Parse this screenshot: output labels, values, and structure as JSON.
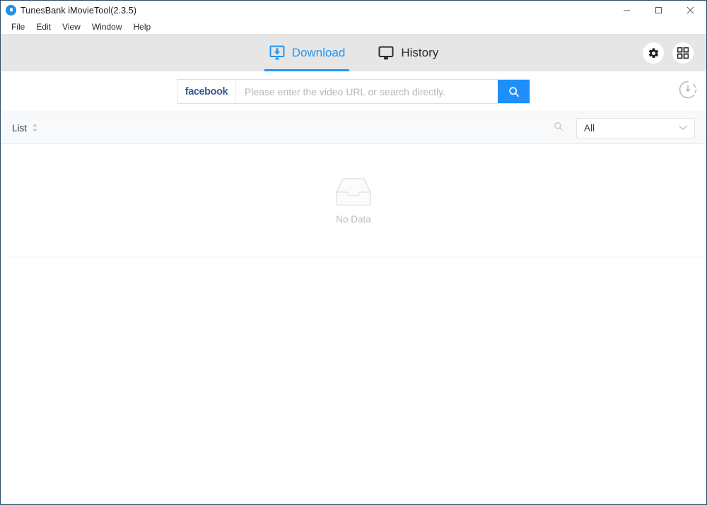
{
  "window": {
    "title": "TunesBank iMovieTool(2.3.5)",
    "app_icon": "tunesbank-logo-icon",
    "controls": {
      "minimize": "minimize-icon",
      "maximize": "maximize-icon",
      "close": "close-icon"
    },
    "accent_color": "#2196f3",
    "navbar_bg": "#e6e6e6"
  },
  "menubar": {
    "items": [
      {
        "label": "File"
      },
      {
        "label": "Edit"
      },
      {
        "label": "View"
      },
      {
        "label": "Window"
      },
      {
        "label": "Help"
      }
    ]
  },
  "navbar": {
    "tabs": [
      {
        "label": "Download",
        "icon": "monitor-download-icon",
        "active": true
      },
      {
        "label": "History",
        "icon": "monitor-icon",
        "active": false
      }
    ],
    "actions": [
      {
        "name": "settings-button",
        "icon": "gear-icon"
      },
      {
        "name": "apps-grid-button",
        "icon": "grid-icon"
      }
    ]
  },
  "search": {
    "site_badge": "facebook",
    "site_badge_color": "#3b5998",
    "placeholder": "Please enter the video URL or search directly.",
    "value": "",
    "button_icon": "search-icon",
    "button_color": "#1e8ffa",
    "download_indicator_icon": "download-progress-icon"
  },
  "toolbar": {
    "list_label": "List",
    "sort_icon": "sort-arrows-icon",
    "search_icon": "search-icon",
    "filter": {
      "selected": "All",
      "options": [
        "All"
      ],
      "chevron": "chevron-down-icon"
    }
  },
  "content": {
    "empty_state": {
      "icon": "empty-inbox-icon",
      "text": "No Data"
    }
  }
}
